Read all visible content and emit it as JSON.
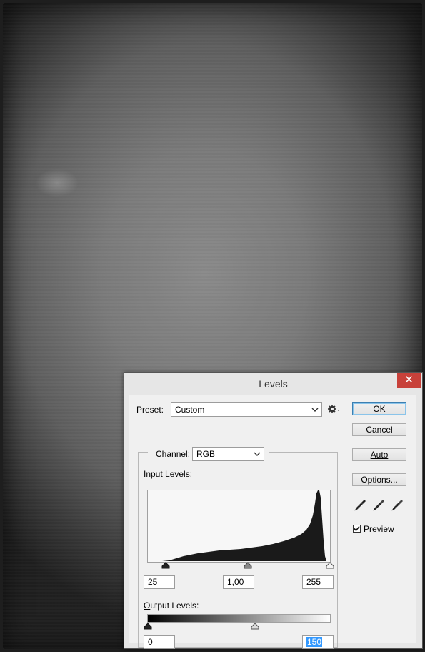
{
  "dialog": {
    "title": "Levels",
    "close_glyph": "✕",
    "preset_label": "Preset:",
    "preset_value": "Custom",
    "channel_label": "Channel:",
    "channel_value": "RGB",
    "input_levels_label": "Input Levels:",
    "input_black": "25",
    "input_gamma": "1,00",
    "input_white": "255",
    "output_levels_label": "Output Levels:",
    "output_black": "0",
    "output_white": "150"
  },
  "buttons": {
    "ok": "OK",
    "cancel": "Cancel",
    "auto": "Auto",
    "options": "Options..."
  },
  "preview": {
    "label": "Preview",
    "checked": true
  },
  "icons": {
    "preset_options": "gear-icon",
    "black_eyedropper": "eyedropper-icon",
    "gray_eyedropper": "eyedropper-icon",
    "white_eyedropper": "eyedropper-icon"
  },
  "colors": {
    "close_button": "#c8413a",
    "default_button_border": "#3c7fb1",
    "selection": "#3399ff"
  }
}
